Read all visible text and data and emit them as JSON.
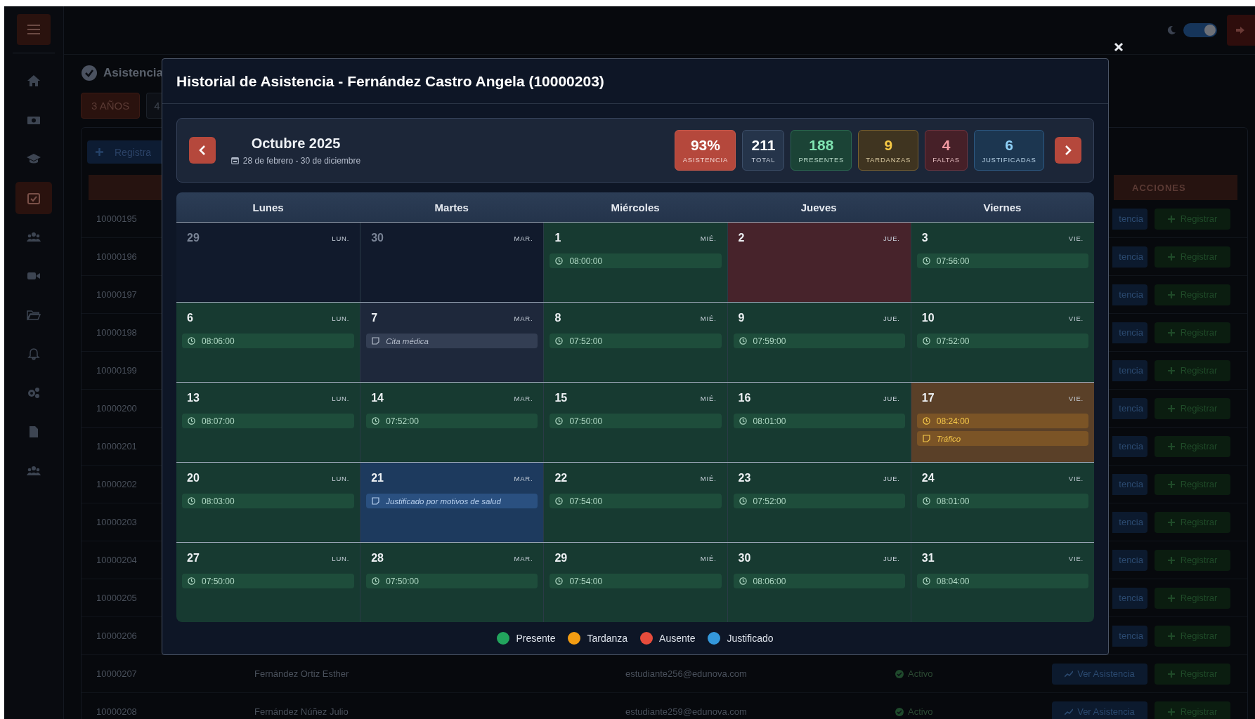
{
  "sidebar": {
    "items": [
      {
        "selected": false
      },
      {
        "selected": false
      },
      {
        "selected": false
      },
      {
        "selected": true
      },
      {
        "selected": false
      },
      {
        "selected": false
      },
      {
        "selected": false
      },
      {
        "selected": false
      },
      {
        "selected": false
      },
      {
        "selected": false
      },
      {
        "selected": false
      }
    ]
  },
  "topbar": {
    "dark_mode": true
  },
  "page": {
    "title": "Asistencia",
    "tabs": [
      {
        "label": "3 AÑOS",
        "selected": true
      },
      {
        "label": "4",
        "selected": false
      }
    ],
    "add_button": "Registra"
  },
  "table": {
    "header": "ACCIONES",
    "rows": [
      {
        "id": "10000195",
        "view": "tencia",
        "register": "Registrar"
      },
      {
        "id": "10000196",
        "view": "tencia",
        "register": "Registrar"
      },
      {
        "id": "10000197",
        "view": "tencia",
        "register": "Registrar"
      },
      {
        "id": "10000198",
        "view": "tencia",
        "register": "Registrar"
      },
      {
        "id": "10000199",
        "view": "tencia",
        "register": "Registrar"
      },
      {
        "id": "10000200",
        "view": "tencia",
        "register": "Registrar"
      },
      {
        "id": "10000201",
        "view": "tencia",
        "register": "Registrar"
      },
      {
        "id": "10000202",
        "view": "tencia",
        "register": "Registrar"
      },
      {
        "id": "10000203",
        "view": "tencia",
        "register": "Registrar"
      },
      {
        "id": "10000204",
        "view": "tencia",
        "register": "Registrar"
      },
      {
        "id": "10000205",
        "view": "tencia",
        "register": "Registrar"
      },
      {
        "id": "10000206",
        "view": "tencia",
        "register": "Registrar"
      },
      {
        "id": "10000207",
        "name": "Fernández Ortiz Esther",
        "email": "estudiante256@edunova.com",
        "status": "Activo",
        "view": "Ver Asistencia",
        "register": "Registrar"
      },
      {
        "id": "10000208",
        "name": "Fernández Núñez Julio",
        "email": "estudiante259@edunova.com",
        "status": "Activo",
        "view": "Ver Asistencia",
        "register": "Registrar"
      }
    ]
  },
  "modal": {
    "title": "Historial de Asistencia - Fernández Castro Angela (10000203)",
    "month": "Octubre 2025",
    "range": "28 de febrero - 30 de diciembre",
    "stats": [
      {
        "value": "93%",
        "label": "ASISTENCIA",
        "kind": "rate"
      },
      {
        "value": "211",
        "label": "TOTAL",
        "kind": "total"
      },
      {
        "value": "188",
        "label": "PRESENTES",
        "kind": "present"
      },
      {
        "value": "9",
        "label": "TARDANZAS",
        "kind": "late"
      },
      {
        "value": "4",
        "label": "FALTAS",
        "kind": "absent"
      },
      {
        "value": "6",
        "label": "JUSTIFICADAS",
        "kind": "justified"
      }
    ],
    "calendar": {
      "weekdays": [
        "Lunes",
        "Martes",
        "Miércoles",
        "Jueves",
        "Viernes"
      ],
      "weeks": [
        {
          "days": [
            {
              "day": "29",
              "weekday": "LUN.",
              "kind": "outside"
            },
            {
              "day": "30",
              "weekday": "MAR.",
              "kind": "outside"
            },
            {
              "day": "1",
              "weekday": "MIÉ.",
              "kind": "present",
              "entries": [
                {
                  "kind": "time",
                  "text": "08:00:00"
                }
              ]
            },
            {
              "day": "2",
              "weekday": "JUE.",
              "kind": "absent"
            },
            {
              "day": "3",
              "weekday": "VIE.",
              "kind": "present",
              "entries": [
                {
                  "kind": "time",
                  "text": "07:56:00"
                }
              ]
            }
          ]
        },
        {
          "days": [
            {
              "day": "6",
              "weekday": "LUN.",
              "kind": "present",
              "entries": [
                {
                  "kind": "time",
                  "text": "08:06:00"
                }
              ]
            },
            {
              "day": "7",
              "weekday": "MAR.",
              "kind": "neutral",
              "entries": [
                {
                  "kind": "note",
                  "text": "Cita médica"
                }
              ]
            },
            {
              "day": "8",
              "weekday": "MIÉ.",
              "kind": "present",
              "entries": [
                {
                  "kind": "time",
                  "text": "07:52:00"
                }
              ]
            },
            {
              "day": "9",
              "weekday": "JUE.",
              "kind": "present",
              "entries": [
                {
                  "kind": "time",
                  "text": "07:59:00"
                }
              ]
            },
            {
              "day": "10",
              "weekday": "VIE.",
              "kind": "present",
              "entries": [
                {
                  "kind": "time",
                  "text": "07:52:00"
                }
              ]
            }
          ]
        },
        {
          "days": [
            {
              "day": "13",
              "weekday": "LUN.",
              "kind": "present",
              "entries": [
                {
                  "kind": "time",
                  "text": "08:07:00"
                }
              ]
            },
            {
              "day": "14",
              "weekday": "MAR.",
              "kind": "present",
              "entries": [
                {
                  "kind": "time",
                  "text": "07:52:00"
                }
              ]
            },
            {
              "day": "15",
              "weekday": "MIÉ.",
              "kind": "present",
              "entries": [
                {
                  "kind": "time",
                  "text": "07:50:00"
                }
              ]
            },
            {
              "day": "16",
              "weekday": "JUE.",
              "kind": "present",
              "entries": [
                {
                  "kind": "time",
                  "text": "08:01:00"
                }
              ]
            },
            {
              "day": "17",
              "weekday": "VIE.",
              "kind": "late",
              "entries": [
                {
                  "kind": "time",
                  "text": "08:24:00"
                },
                {
                  "kind": "note",
                  "text": "Tráfico"
                }
              ]
            }
          ]
        },
        {
          "days": [
            {
              "day": "20",
              "weekday": "LUN.",
              "kind": "present",
              "entries": [
                {
                  "kind": "time",
                  "text": "08:03:00"
                }
              ]
            },
            {
              "day": "21",
              "weekday": "MAR.",
              "kind": "justified",
              "entries": [
                {
                  "kind": "note",
                  "text": "Justificado por motivos de salud"
                }
              ]
            },
            {
              "day": "22",
              "weekday": "MIÉ.",
              "kind": "present",
              "entries": [
                {
                  "kind": "time",
                  "text": "07:54:00"
                }
              ]
            },
            {
              "day": "23",
              "weekday": "JUE.",
              "kind": "present",
              "entries": [
                {
                  "kind": "time",
                  "text": "07:52:00"
                }
              ]
            },
            {
              "day": "24",
              "weekday": "VIE.",
              "kind": "present",
              "entries": [
                {
                  "kind": "time",
                  "text": "08:01:00"
                }
              ]
            }
          ]
        },
        {
          "days": [
            {
              "day": "27",
              "weekday": "LUN.",
              "kind": "present",
              "entries": [
                {
                  "kind": "time",
                  "text": "07:50:00"
                }
              ]
            },
            {
              "day": "28",
              "weekday": "MAR.",
              "kind": "present",
              "entries": [
                {
                  "kind": "time",
                  "text": "07:50:00"
                }
              ]
            },
            {
              "day": "29",
              "weekday": "MIÉ.",
              "kind": "present",
              "entries": [
                {
                  "kind": "time",
                  "text": "07:54:00"
                }
              ]
            },
            {
              "day": "30",
              "weekday": "JUE.",
              "kind": "present",
              "entries": [
                {
                  "kind": "time",
                  "text": "08:06:00"
                }
              ]
            },
            {
              "day": "31",
              "weekday": "VIE.",
              "kind": "present",
              "entries": [
                {
                  "kind": "time",
                  "text": "08:04:00"
                }
              ]
            }
          ]
        }
      ]
    },
    "legend": [
      {
        "label": "Presente",
        "color": "#22a45d"
      },
      {
        "label": "Tardanza",
        "color": "#f39c12"
      },
      {
        "label": "Ausente",
        "color": "#e74c3c"
      },
      {
        "label": "Justificado",
        "color": "#3498db"
      }
    ]
  }
}
